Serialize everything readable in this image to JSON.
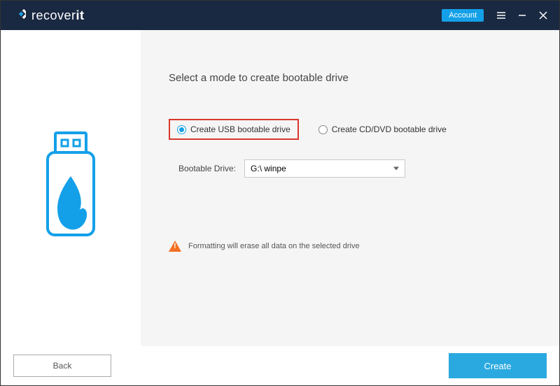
{
  "titlebar": {
    "brand_prefix": "recover",
    "brand_suffix": "it",
    "account_label": "Account"
  },
  "main": {
    "heading": "Select a mode to create bootable drive",
    "option_usb": "Create USB bootable drive",
    "option_cddvd": "Create CD/DVD bootable drive",
    "drive_label": "Bootable Drive:",
    "selected_drive": "G:\\ winpe",
    "warning_text": "Formatting will erase all data on the selected drive"
  },
  "footer": {
    "back_label": "Back",
    "create_label": "Create"
  },
  "icons": {
    "logo": "recoverit-logo-icon",
    "menu": "hamburger-icon",
    "minimize": "minimize-icon",
    "close": "close-icon",
    "usb": "usb-flame-illustration",
    "warn": "warning-triangle-icon",
    "chevron": "chevron-down-icon"
  },
  "colors": {
    "accent": "#14a0e8",
    "header": "#1a2942",
    "highlight": "#d9372c",
    "warn": "#f36f21"
  }
}
